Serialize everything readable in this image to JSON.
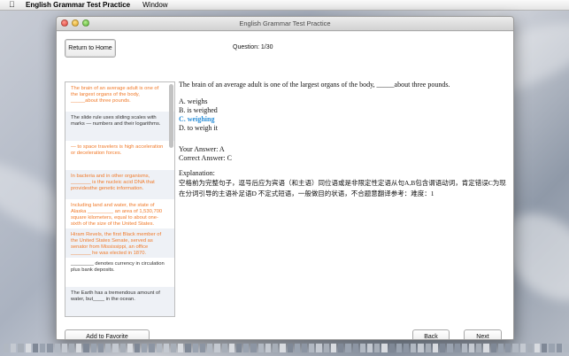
{
  "menubar": {
    "app_name": "English Grammar Test Practice",
    "menus": [
      "Window"
    ]
  },
  "window": {
    "title": "English Grammar Test Practice"
  },
  "toolbar": {
    "home_label": "Return to Home",
    "question_counter": "Question:  1/30"
  },
  "sidebar": {
    "items": [
      {
        "text": "The brain of an average adult is one of the largest organs of the body, _____about three pounds.",
        "style": "orange"
      },
      {
        "text": "The slide rule uses sliding scales with marks — numbers and their logarithms.",
        "style": "dark"
      },
      {
        "text": "— to space travelers is high acceleration or deceleration forces.",
        "style": "orange"
      },
      {
        "text": "In bacteria and in other organisms, _______ is the nucleic acid DNA that providesthe genetic information.",
        "style": "orange"
      },
      {
        "text": "Including land and water, the state of Alaska _________ an area of 1,530,700 square kilometers, equal to about one-sixth of the size of the United States.",
        "style": "orange"
      },
      {
        "text": "Hiram Revels, the first Black member of the United States Senate, served as senator from Mississippi, an office _______ he was elected in 1870.",
        "style": "orange"
      },
      {
        "text": "________ denotes currency in circulation plus bank deposits.",
        "style": "dark"
      },
      {
        "text": "The Earth has a tremendous amount of water, but____ in the ocean.",
        "style": "dark"
      }
    ]
  },
  "question": {
    "text": "The brain of an average adult is one of the largest organs of the body, _____about three pounds.",
    "options": [
      "A. weighs",
      "B. is weighed",
      "C. weighing",
      "D. to weigh it"
    ],
    "correct_index": 2,
    "your_answer": "Your Answer: A",
    "correct_answer": "Correct Answer: C",
    "explanation_label": "Explanation:",
    "explanation": "空格前为完整句子，逗号后应为宾语（和主语）同位语或是非限定性定语从句A,B包含谓语动词，肯定错误C为现在分词引导的主语补足语D 不定式短语，一般做目的状语，不合题意翻译参考：难度：1"
  },
  "footer": {
    "favorite_label": "Add to Favorite",
    "back_label": "Back",
    "next_label": "Next"
  },
  "colors": {
    "accent_orange": "#f07a2a",
    "correct_blue": "#2a8fd8"
  }
}
